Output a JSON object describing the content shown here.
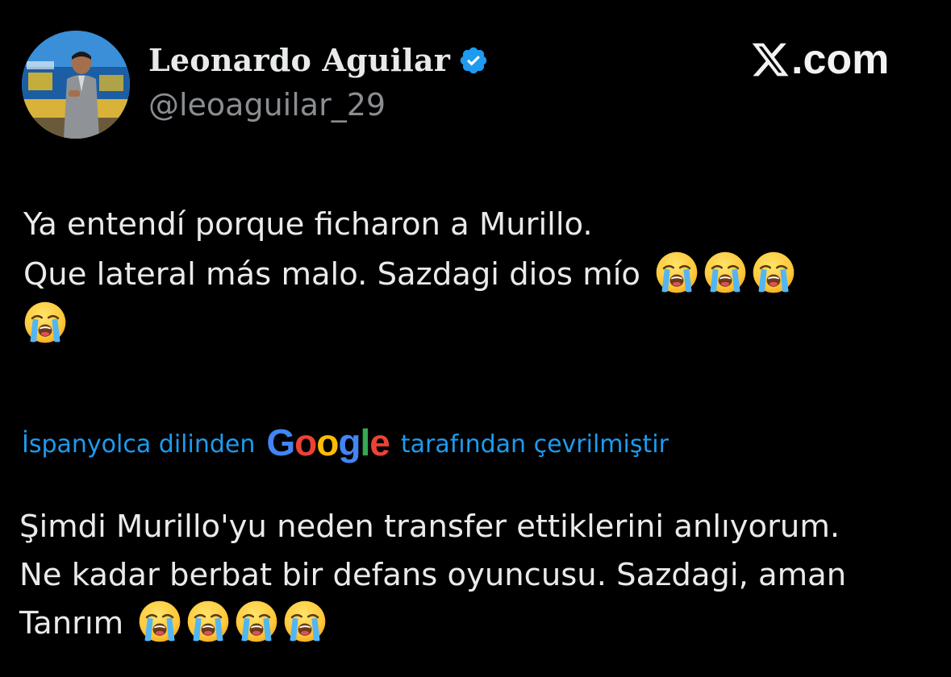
{
  "author": {
    "display_name": "Leonardo Aguilar",
    "handle": "@leoaguilar_29",
    "verified": true,
    "verified_color": "#1d9bf0"
  },
  "brand": {
    "x_glyph": "𝕏",
    "suffix": ".com"
  },
  "post": {
    "line1": "Ya entendí porque ficharon a Murillo.",
    "line2": "Que lateral más malo. Sazdagi dios mío",
    "emoji": "loudly-crying-face-icon",
    "emoji_count": 4
  },
  "translation": {
    "prefix": "İspanyolca dilinden",
    "provider": "Google",
    "suffix": "tarafından çevrilmiştir",
    "link_color": "#1d9bf0",
    "google_colors": [
      "#4285f4",
      "#ea4335",
      "#fbbc05",
      "#4285f4",
      "#34a853",
      "#ea4335"
    ]
  },
  "translated_post": {
    "line1": "Şimdi Murillo'yu neden transfer ettiklerini anlıyorum.",
    "line2": "Ne kadar berbat bir defans oyuncusu. Sazdagi, aman",
    "line3": "Tanrım",
    "emoji": "loudly-crying-face-icon",
    "emoji_count": 4
  }
}
